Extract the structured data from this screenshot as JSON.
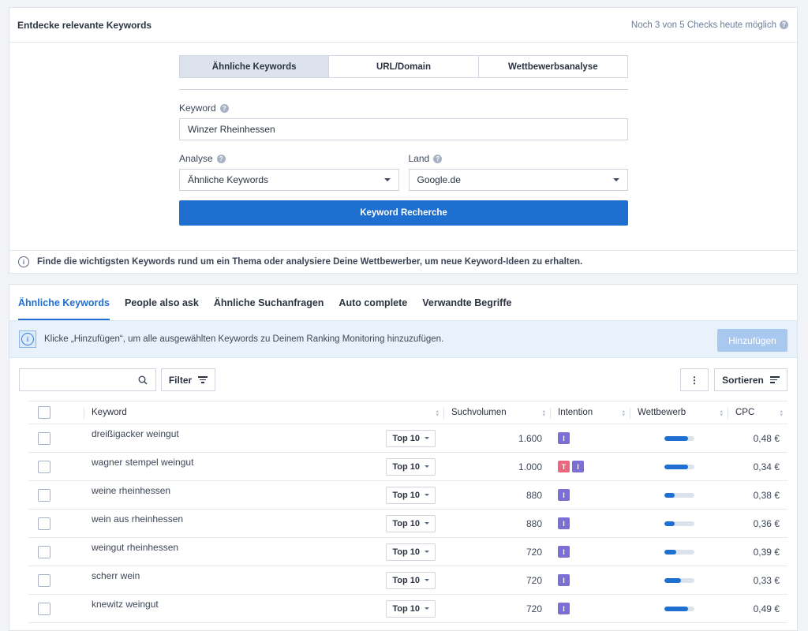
{
  "header": {
    "title": "Entdecke relevante Keywords",
    "checks": "Noch 3 von 5 Checks heute möglich"
  },
  "mode_tabs": [
    "Ähnliche Keywords",
    "URL/Domain",
    "Wettbewerbsanalyse"
  ],
  "form": {
    "keyword_label": "Keyword",
    "keyword_value": "Winzer Rheinhessen",
    "analyse_label": "Analyse",
    "analyse_value": "Ähnliche Keywords",
    "land_label": "Land",
    "land_value": "Google.de",
    "submit_label": "Keyword Recherche"
  },
  "info_text": "Finde die wichtigsten Keywords rund um ein Thema oder analysiere Deine Wettbewerber, um neue Keyword-Ideen zu erhalten.",
  "result_tabs": [
    "Ähnliche Keywords",
    "People also ask",
    "Ähnliche Suchanfragen",
    "Auto complete",
    "Verwandte Begriffe"
  ],
  "notice": {
    "text": "Klicke „Hinzufügen“, um alle ausgewählten Keywords zu Deinem Ranking Monitoring hinzuzufügen.",
    "button": "Hinzufügen"
  },
  "toolbar": {
    "filter_label": "Filter",
    "more_label": "⋮",
    "sort_label": "Sortieren"
  },
  "table": {
    "columns": [
      "Keyword",
      "Suchvolumen",
      "Intention",
      "Wettbewerb",
      "CPC"
    ],
    "rows": [
      {
        "keyword": "dreißigacker weingut",
        "rank": "Top 10",
        "volume": "1.600",
        "intent": [
          "I"
        ],
        "competition": 0.8,
        "cpc": "0,48 €"
      },
      {
        "keyword": "wagner stempel weingut",
        "rank": "Top 10",
        "volume": "1.000",
        "intent": [
          "T",
          "I"
        ],
        "competition": 0.8,
        "cpc": "0,34 €"
      },
      {
        "keyword": "weine rheinhessen",
        "rank": "Top 10",
        "volume": "880",
        "intent": [
          "I"
        ],
        "competition": 0.35,
        "cpc": "0,38 €"
      },
      {
        "keyword": "wein aus rheinhessen",
        "rank": "Top 10",
        "volume": "880",
        "intent": [
          "I"
        ],
        "competition": 0.35,
        "cpc": "0,36 €"
      },
      {
        "keyword": "weingut rheinhessen",
        "rank": "Top 10",
        "volume": "720",
        "intent": [
          "I"
        ],
        "competition": 0.4,
        "cpc": "0,39 €"
      },
      {
        "keyword": "scherr wein",
        "rank": "Top 10",
        "volume": "720",
        "intent": [
          "I"
        ],
        "competition": 0.55,
        "cpc": "0,33 €"
      },
      {
        "keyword": "knewitz weingut",
        "rank": "Top 10",
        "volume": "720",
        "intent": [
          "I"
        ],
        "competition": 0.8,
        "cpc": "0,49 €"
      }
    ]
  },
  "colors": {
    "accent": "#1f6fd1",
    "intent_I": "#7b6fd6",
    "intent_T": "#e9677f"
  }
}
